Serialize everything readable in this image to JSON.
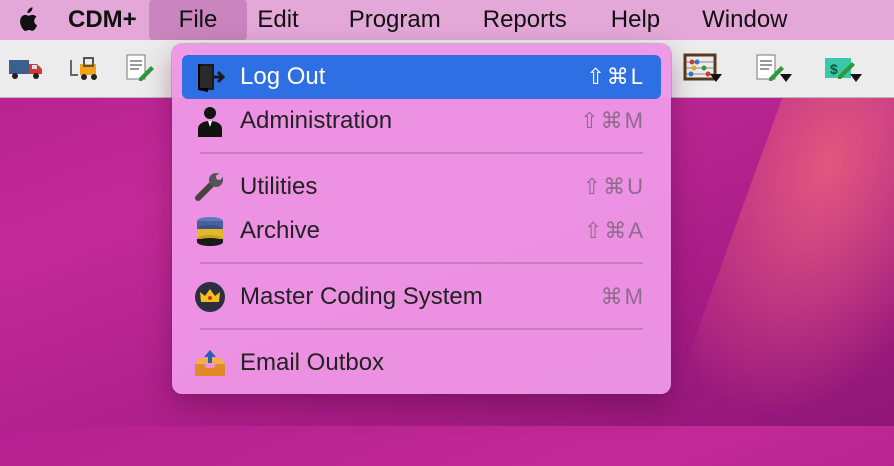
{
  "menubar": {
    "app_name": "CDM+",
    "items": [
      "File",
      "Edit",
      "Program",
      "Reports",
      "Help",
      "Window"
    ]
  },
  "toolbar": {
    "left_icons": [
      "delivery-truck-icon",
      "forklift-icon",
      "document-edit-icon"
    ],
    "right_icons": [
      "abacus-icon",
      "document-edit-icon",
      "money-edit-icon"
    ]
  },
  "file_menu": {
    "items": [
      {
        "label": "Log Out",
        "shortcut": "⇧⌘L",
        "icon": "log-out-door-icon",
        "selected": true
      },
      {
        "label": "Administration",
        "shortcut": "⇧⌘M",
        "icon": "admin-person-icon"
      },
      {
        "label": "Utilities",
        "shortcut": "⇧⌘U",
        "icon": "wrench-icon"
      },
      {
        "label": "Archive",
        "shortcut": "⇧⌘A",
        "icon": "database-icon"
      },
      {
        "label": "Master Coding System",
        "shortcut": "⌘M",
        "icon": "crown-icon"
      },
      {
        "label": "Email Outbox",
        "shortcut": "",
        "icon": "outbox-tray-icon"
      }
    ]
  },
  "colors": {
    "selection": "#2f6fe4",
    "menu_bg": "#ee96e6",
    "desktop": "#b4208f"
  }
}
